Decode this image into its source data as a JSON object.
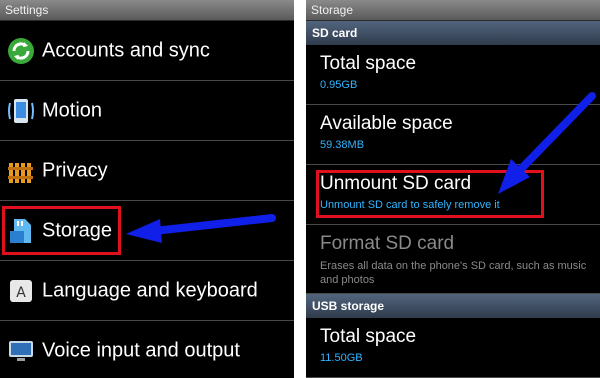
{
  "settings": {
    "title": "Settings",
    "items": [
      {
        "label": "Accounts and sync",
        "icon": "sync-icon"
      },
      {
        "label": "Motion",
        "icon": "motion-phone-icon"
      },
      {
        "label": "Privacy",
        "icon": "privacy-fence-icon"
      },
      {
        "label": "Storage",
        "icon": "sd-card-icon"
      },
      {
        "label": "Language and keyboard",
        "icon": "keyboard-icon"
      },
      {
        "label": "Voice input and output",
        "icon": "monitor-icon"
      }
    ]
  },
  "storage": {
    "title": "Storage",
    "sections": [
      {
        "header": "SD card",
        "items": [
          {
            "title": "Total space",
            "subtitle": "0.95GB"
          },
          {
            "title": "Available space",
            "subtitle": "59.38MB"
          },
          {
            "title": "Unmount SD card",
            "subtitle": "Unmount SD card to safely remove it"
          },
          {
            "title": "Format SD card",
            "subtitle": "Erases all data on the phone's SD card, such as music and photos"
          }
        ]
      },
      {
        "header": "USB storage",
        "items": [
          {
            "title": "Total space",
            "subtitle": "11.50GB"
          }
        ]
      }
    ]
  },
  "colors": {
    "highlight": "#e0101c",
    "arrow": "#1020e8",
    "subtitle": "#31b4ff"
  }
}
